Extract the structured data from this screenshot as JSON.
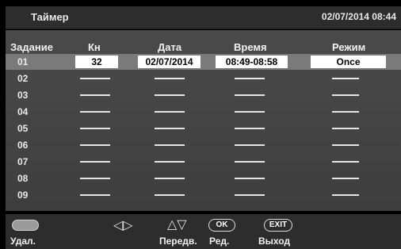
{
  "header": {
    "title": "Таймер",
    "datetime": "02/07/2014 08:44"
  },
  "columns": {
    "task": "Задание",
    "channel": "Кн",
    "date": "Дата",
    "time": "Время",
    "mode": "Режим"
  },
  "rows": [
    {
      "num": "01",
      "channel": "32",
      "date": "02/07/2014",
      "time": "08:49-08:58",
      "mode": "Once"
    },
    {
      "num": "02"
    },
    {
      "num": "03"
    },
    {
      "num": "04"
    },
    {
      "num": "05"
    },
    {
      "num": "06"
    },
    {
      "num": "07"
    },
    {
      "num": "08"
    },
    {
      "num": "09"
    }
  ],
  "footer": {
    "delete_label": "Удал.",
    "move_label": "Передв.",
    "ok_key": "OK",
    "edit_label": "Ред.",
    "exit_key": "EXIT",
    "exit_label": "Выход"
  }
}
